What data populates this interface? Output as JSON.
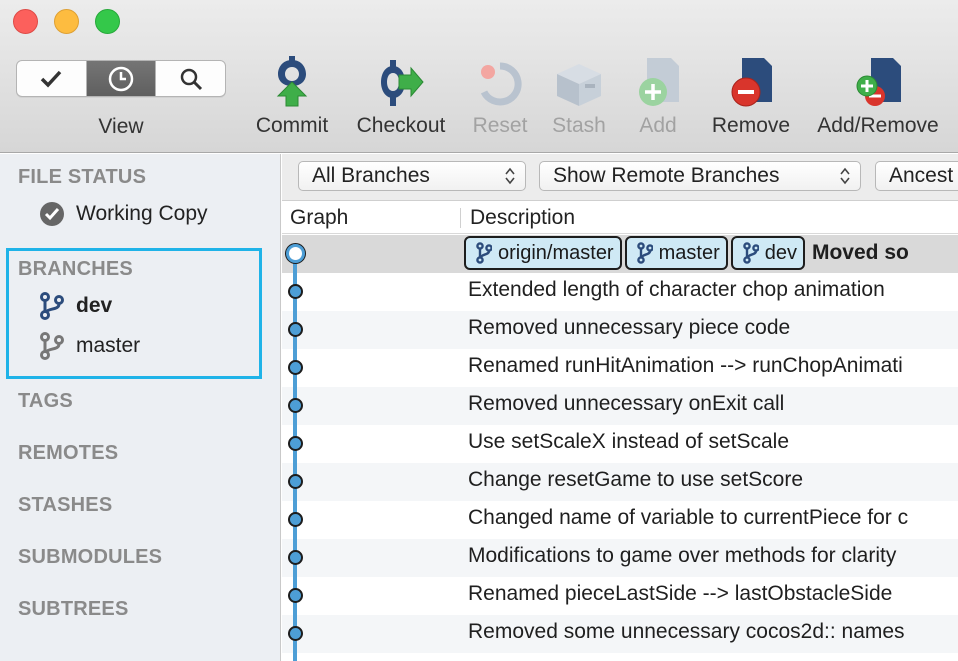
{
  "toolbar": {
    "view_label": "View",
    "segments": [
      {
        "icon": "checkmark-icon"
      },
      {
        "icon": "clock-icon"
      },
      {
        "icon": "search-icon"
      }
    ],
    "actions": [
      {
        "label": "Commit",
        "icon": "commit-icon",
        "enabled": true
      },
      {
        "label": "Checkout",
        "icon": "checkout-icon",
        "enabled": true
      },
      {
        "label": "Reset",
        "icon": "reset-icon",
        "enabled": false
      },
      {
        "label": "Stash",
        "icon": "stash-icon",
        "enabled": false
      },
      {
        "label": "Add",
        "icon": "add-file-icon",
        "enabled": false
      },
      {
        "label": "Remove",
        "icon": "remove-file-icon",
        "enabled": true
      },
      {
        "label": "Add/Remove",
        "icon": "add-remove-icon",
        "enabled": true
      }
    ]
  },
  "sidebar": {
    "file_status": "FILE STATUS",
    "working_copy": "Working Copy",
    "branches": "BRANCHES",
    "branch_items": [
      {
        "label": "dev",
        "current": true
      },
      {
        "label": "master",
        "current": false
      }
    ],
    "tags": "TAGS",
    "remotes": "REMOTES",
    "stashes": "STASHES",
    "submodules": "SUBMODULES",
    "subtrees": "SUBTREES"
  },
  "filters": {
    "branches": "All Branches",
    "remote": "Show Remote Branches",
    "order": "Ancest"
  },
  "columns": {
    "graph": "Graph",
    "description": "Description"
  },
  "commits": {
    "head": {
      "tags": [
        "origin/master",
        "master",
        "dev"
      ],
      "message": "Moved so"
    },
    "rows": [
      "Extended length of character chop animation",
      "Removed unnecessary piece code",
      "Renamed runHitAnimation --> runChopAnimati",
      "Removed unnecessary onExit call",
      "Use setScaleX instead of setScale",
      "Change resetGame to use setScore",
      "Changed name of variable to currentPiece for c",
      "Modifications to game over methods for clarity",
      "Renamed pieceLastSide --> lastObstacleSide",
      "Removed some unnecessary cocos2d:: names",
      ""
    ]
  },
  "colors": {
    "accent_graph": "#4d9ed6",
    "highlight_box": "#1fb3e8",
    "tag_bg": "#cfe9f5"
  }
}
